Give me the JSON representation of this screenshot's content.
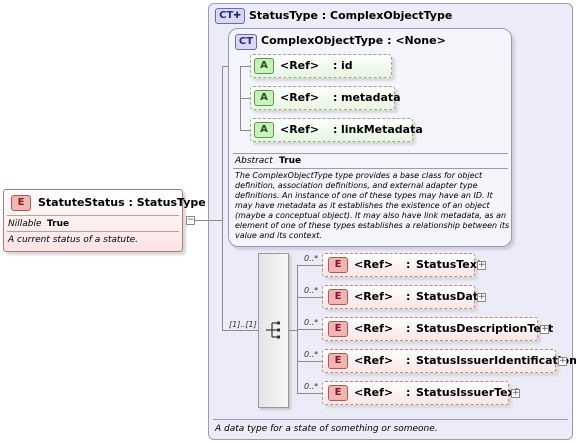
{
  "root_element": {
    "badge": "E",
    "name": "StatuteStatus",
    "type": "StatusType",
    "nillable_label": "Nillable",
    "nillable_value": "True",
    "description": "A current status of a statute."
  },
  "complex_type": {
    "badge": "CT",
    "name": "StatusType",
    "base_type": "ComplexObjectType",
    "description": "A data type for a state of something or someone."
  },
  "base_type": {
    "badge": "CT",
    "name": "ComplexObjectType",
    "base": "<None>",
    "abstract_label": "Abstract",
    "abstract_value": "True",
    "description": "The ComplexObjectType type provides a base class for object definition, association definitions, and external adapter type definitions. An instance of one of these types may have an ID. It may have metadata as it establishes the existence of an object (maybe a conceptual object). It may also have link metadata, as an element of one of these types establishes a relationship between its value and its context."
  },
  "separator": ":",
  "ref_label": "<Ref>",
  "attributes": [
    {
      "badge": "A",
      "name": "id"
    },
    {
      "badge": "A",
      "name": "metadata"
    },
    {
      "badge": "A",
      "name": "linkMetadata"
    }
  ],
  "sequence_occurrence": "[1]..[1]",
  "child_elements": [
    {
      "badge": "E",
      "occurrence": "0..*",
      "name": "StatusText"
    },
    {
      "badge": "E",
      "occurrence": "0..*",
      "name": "StatusDate"
    },
    {
      "badge": "E",
      "occurrence": "0..*",
      "name": "StatusDescriptionText"
    },
    {
      "badge": "E",
      "occurrence": "0..*",
      "name": "StatusIssuerIdentification"
    },
    {
      "badge": "E",
      "occurrence": "0..*",
      "name": "StatusIssuerText"
    }
  ]
}
